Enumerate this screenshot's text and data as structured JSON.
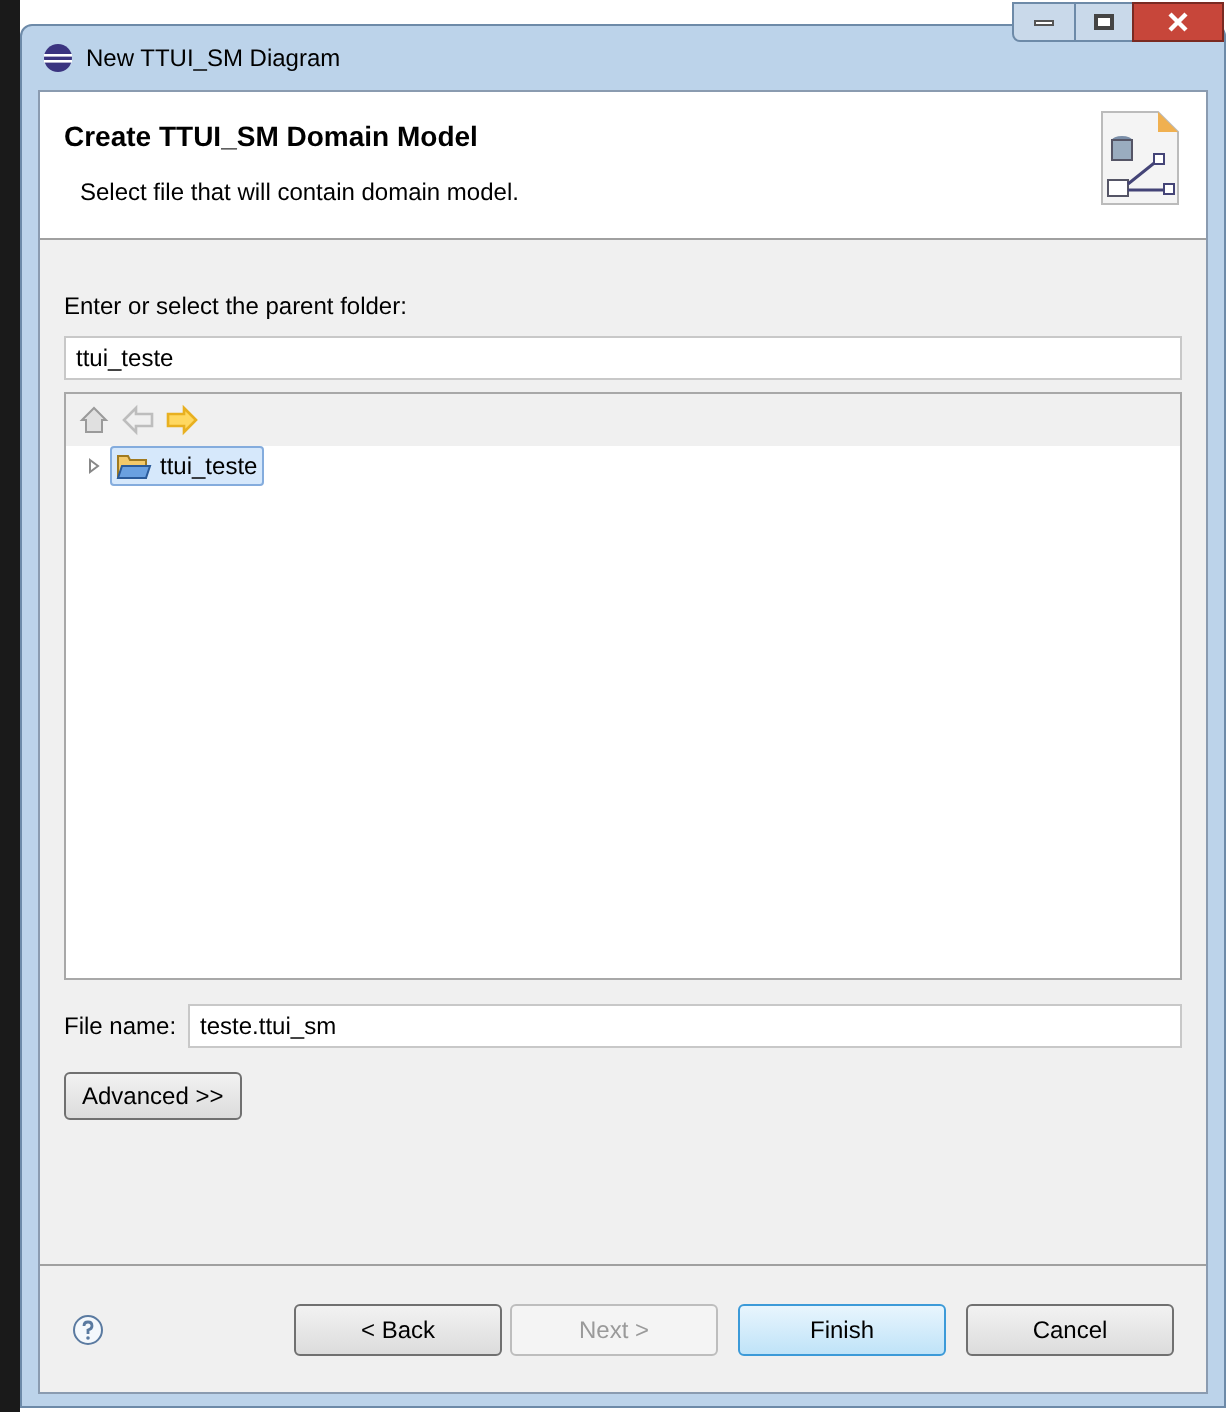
{
  "window": {
    "title": "New TTUI_SM Diagram"
  },
  "header": {
    "title": "Create TTUI_SM Domain Model",
    "description": "Select file that will contain domain model."
  },
  "parent_folder": {
    "label": "Enter or select the parent folder:",
    "value": "ttui_teste"
  },
  "navigation": [
    {
      "kind": "home",
      "disabled": true
    },
    {
      "kind": "back",
      "disabled": true
    },
    {
      "kind": "forward",
      "disabled": false
    }
  ],
  "tree": {
    "items": [
      {
        "label": "ttui_teste",
        "selected": true,
        "expanded": false
      }
    ]
  },
  "file_name": {
    "label": "File name:",
    "value": "teste.ttui_sm"
  },
  "advanced_button": "Advanced >>",
  "buttons": [
    {
      "label": "< Back",
      "disabled": false,
      "default": false
    },
    {
      "label": "Next >",
      "disabled": true,
      "default": false
    },
    {
      "label": "Finish",
      "disabled": false,
      "default": true
    },
    {
      "label": "Cancel",
      "disabled": false,
      "default": false
    }
  ]
}
